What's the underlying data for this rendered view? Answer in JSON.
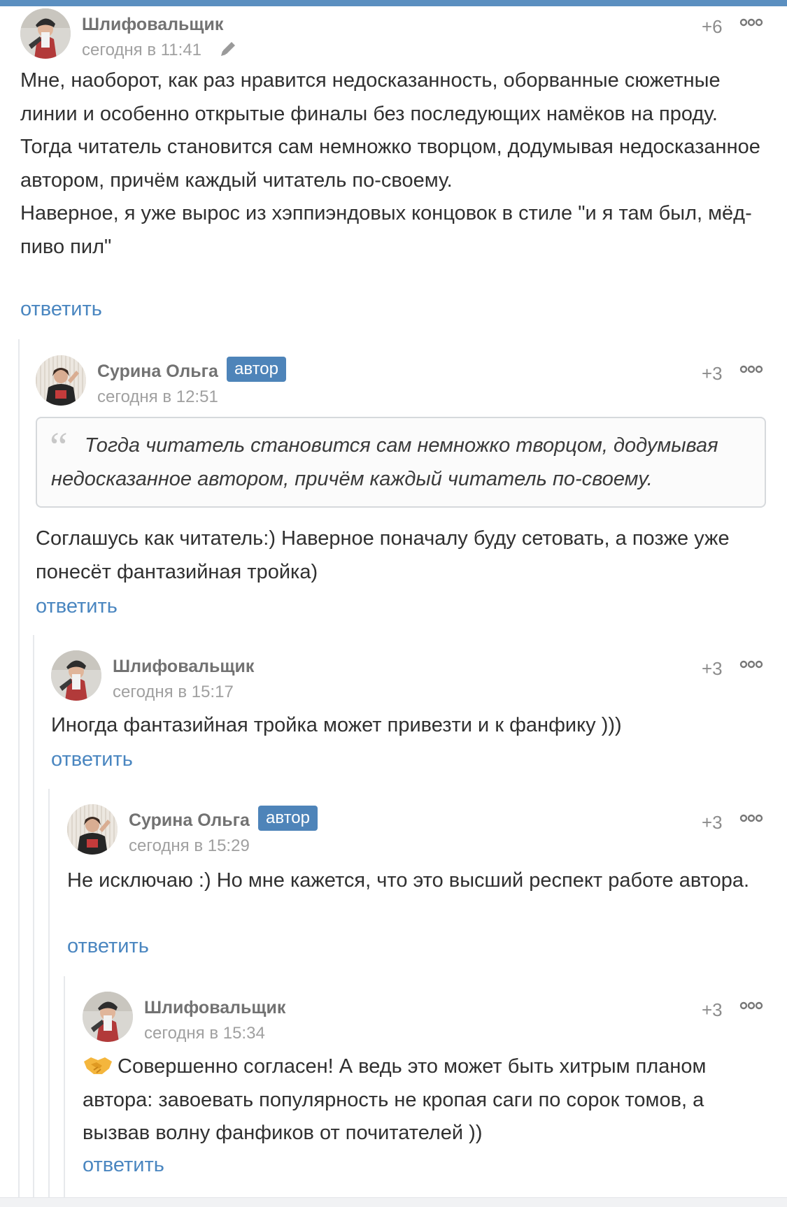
{
  "colors": {
    "accent": "#4e84b9",
    "link": "#4a86c0",
    "top_bar": "#5b8fc0"
  },
  "comments": [
    {
      "author": "Шлифовальщик",
      "time": "сегодня в 11:41",
      "edited_icon": "pencil-icon",
      "rating": "+6",
      "body": "Мне, наоборот, как раз нравится недосказанность, оборванные сюжетные линии и особенно открытые финалы без последующих намёков на проду. Тогда читатель становится сам немножко творцом, додумывая недосказанное автором, причём каждый читатель по-своему.\nНаверное, я уже вырос из хэппиэндовых концовок в стиле \"и я там был, мёд-пиво пил\"",
      "reply": "ответить"
    },
    {
      "author": "Сурина Ольга",
      "badge": "автор",
      "time": "сегодня в 12:51",
      "rating": "+3",
      "quote": "Тогда читатель становится сам немножко творцом, додумывая недосказанное автором, причём каждый читатель по-своему.",
      "body": "Соглашусь как читатель:) Наверное поначалу буду сетовать, а позже уже понесёт фантазийная тройка)",
      "reply": "ответить"
    },
    {
      "author": "Шлифовальщик",
      "time": "сегодня в 15:17",
      "rating": "+3",
      "body": "Иногда фантазийная тройка может привезти и к фанфику )))",
      "reply": "ответить"
    },
    {
      "author": "Сурина Ольга",
      "badge": "автор",
      "time": "сегодня в 15:29",
      "rating": "+3",
      "body": "Не исключаю :) Но мне кажется, что это высший респект работе автора.",
      "reply": "ответить"
    },
    {
      "author": "Шлифовальщик",
      "time": "сегодня в 15:34",
      "rating": "+3",
      "emoji": "handshake-emoji",
      "body": "Совершенно согласен! А ведь это может быть хитрым планом автора: завоевать популярность не кропая саги по сорок томов, а вызвав волну фанфиков от почитателей ))",
      "reply": "ответить"
    }
  ]
}
